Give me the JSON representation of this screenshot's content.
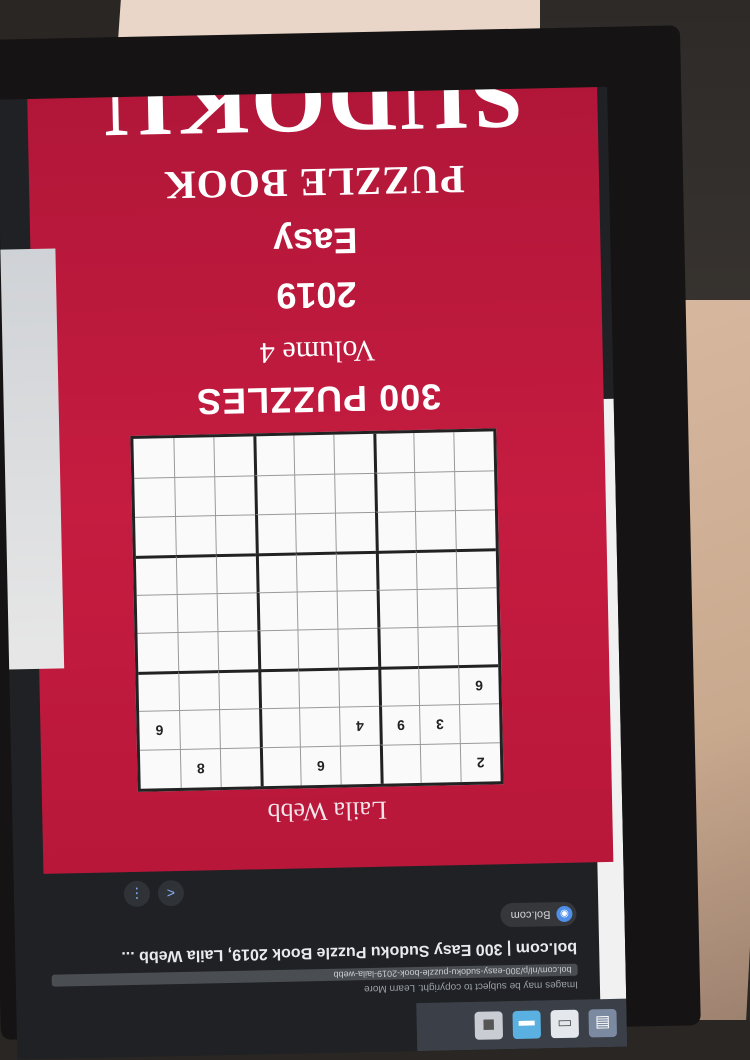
{
  "taskbar": {
    "icons": [
      "files-icon",
      "document-icon",
      "screen-icon",
      "bag-icon"
    ]
  },
  "browser": {
    "copyright_note": "Images may be subject to copyright. Learn More",
    "url": "bol.com/nl/p/300-easy-sudoku-puzzle-book-2019-laila-webb",
    "page_title": "bol.com | 300 Easy Sudoku Puzzle Book 2019, Laila Webb ...",
    "site_name": "Bol.com"
  },
  "cover": {
    "author": "Laila Webb",
    "count": "300 PUZZLES",
    "volume": "Volume 4",
    "year": "2019",
    "level": "Easy",
    "subtitle": "PUZZLE BOOK",
    "title": "SUDOKU",
    "grid": [
      [
        "2",
        "",
        "",
        "",
        "6",
        "",
        "",
        "8",
        ""
      ],
      [
        "",
        "3",
        "9",
        "4",
        "",
        "",
        "",
        "",
        "6"
      ],
      [
        "6",
        "",
        "",
        "",
        "",
        "",
        "",
        "",
        ""
      ],
      [
        "",
        "",
        "",
        "",
        "",
        "",
        "",
        "",
        ""
      ],
      [
        "",
        "",
        "",
        "",
        "",
        "",
        "",
        "",
        ""
      ],
      [
        "",
        "",
        "",
        "",
        "",
        "",
        "",
        "",
        ""
      ],
      [
        "",
        "",
        "",
        "",
        "",
        "",
        "",
        "",
        ""
      ],
      [
        "",
        "",
        "",
        "",
        "",
        "",
        "",
        "",
        ""
      ],
      [
        "",
        "",
        "",
        "",
        "",
        "",
        "",
        "",
        ""
      ]
    ]
  },
  "colors": {
    "cover_red": "#c51c40",
    "screen_bg": "#1f2124"
  }
}
